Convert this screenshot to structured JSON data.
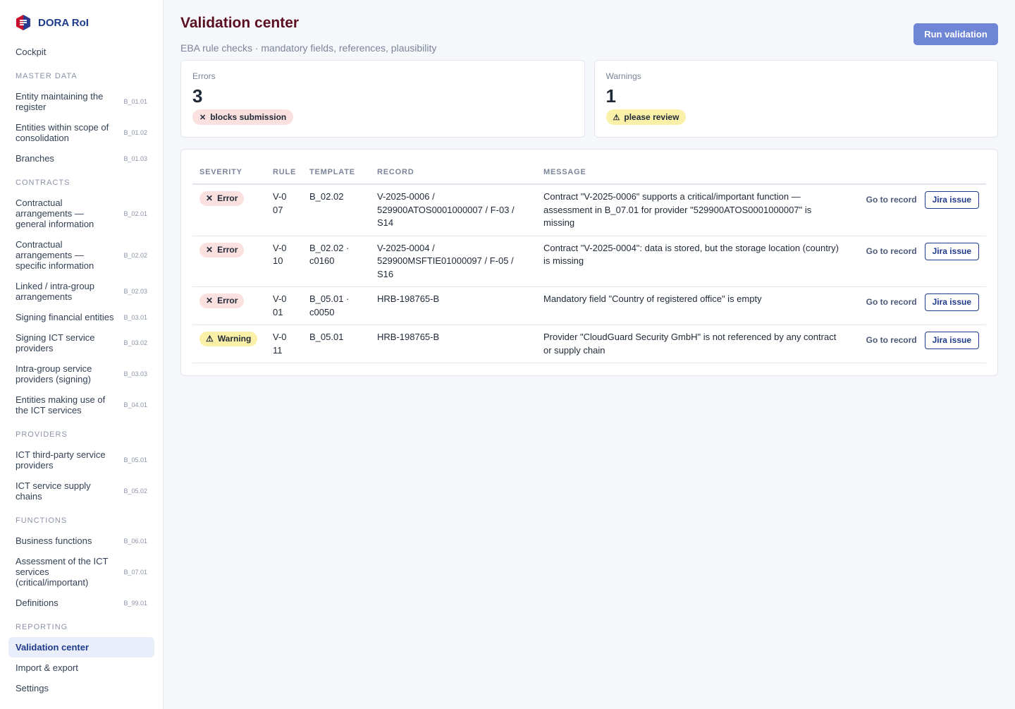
{
  "app": {
    "title": "DORA RoI"
  },
  "sidebar": {
    "cockpit": "Cockpit",
    "sections": {
      "master_data": "MASTER DATA",
      "contracts": "CONTRACTS",
      "providers": "PROVIDERS",
      "functions": "FUNCTIONS",
      "reporting": "REPORTING"
    },
    "items": {
      "b0101": {
        "label": "Entity maintaining the register",
        "code": "B_01.01"
      },
      "b0102": {
        "label": "Entities within scope of consolidation",
        "code": "B_01.02"
      },
      "b0103": {
        "label": "Branches",
        "code": "B_01.03"
      },
      "b0201": {
        "label": "Contractual arrangements — general information",
        "code": "B_02.01"
      },
      "b0202": {
        "label": "Contractual arrangements — specific information",
        "code": "B_02.02"
      },
      "b0203": {
        "label": "Linked / intra-group arrangements",
        "code": "B_02.03"
      },
      "b0301": {
        "label": "Signing financial entities",
        "code": "B_03.01"
      },
      "b0302": {
        "label": "Signing ICT service providers",
        "code": "B_03.02"
      },
      "b0303": {
        "label": "Intra-group service providers (signing)",
        "code": "B_03.03"
      },
      "b0401": {
        "label": "Entities making use of the ICT services",
        "code": "B_04.01"
      },
      "b0501": {
        "label": "ICT third-party service providers",
        "code": "B_05.01"
      },
      "b0502": {
        "label": "ICT service supply chains",
        "code": "B_05.02"
      },
      "b0601": {
        "label": "Business functions",
        "code": "B_06.01"
      },
      "b0701": {
        "label": "Assessment of the ICT services (critical/important)",
        "code": "B_07.01"
      },
      "b9901": {
        "label": "Definitions",
        "code": "B_99.01"
      }
    },
    "validation_center": "Validation center",
    "import_export": "Import & export",
    "settings": "Settings"
  },
  "page": {
    "title": "Validation center",
    "subtitle": "EBA rule checks · mandatory fields, references, plausibility",
    "run_button": "Run validation"
  },
  "summary": {
    "errors": {
      "label": "Errors",
      "value": "3",
      "badge": "blocks submission",
      "badge_icon": "✕"
    },
    "warnings": {
      "label": "Warnings",
      "value": "1",
      "badge": "please review",
      "badge_icon": "⚠"
    }
  },
  "table": {
    "columns": [
      "SEVERITY",
      "RULE",
      "TEMPLATE",
      "RECORD",
      "MESSAGE"
    ],
    "rows": [
      {
        "severity": "Error",
        "severity_icon": "✕",
        "rule": "V-007",
        "template": "B_02.02",
        "record": "V-2025-0006 / 529900ATOS0001000007 / F-03 / S14",
        "message": "Contract \"V-2025-0006\" supports a critical/important function — assessment in B_07.01 for provider \"529900ATOS0001000007\" is missing",
        "goto": "Go to record",
        "jira": "Jira issue"
      },
      {
        "severity": "Error",
        "severity_icon": "✕",
        "rule": "V-010",
        "template": "B_02.02 · c0160",
        "record": "V-2025-0004 / 529900MSFTIE01000097 / F-05 / S16",
        "message": "Contract \"V-2025-0004\": data is stored, but the storage location (country) is missing",
        "goto": "Go to record",
        "jira": "Jira issue"
      },
      {
        "severity": "Error",
        "severity_icon": "✕",
        "rule": "V-001",
        "template": "B_05.01 · c0050",
        "record": "HRB-198765-B",
        "message": "Mandatory field \"Country of registered office\" is empty",
        "goto": "Go to record",
        "jira": "Jira issue"
      },
      {
        "severity": "Warning",
        "severity_icon": "⚠",
        "rule": "V-011",
        "template": "B_05.01",
        "record": "HRB-198765-B",
        "message": "Provider \"CloudGuard Security GmbH\" is not referenced by any contract or supply chain",
        "goto": "Go to record",
        "jira": "Jira issue"
      }
    ]
  },
  "colors": {
    "brand": "#1e3a8a",
    "title": "#5b1022",
    "primary_button": "#6f86d6",
    "error_pill": "#fbe0e0",
    "warning_pill": "#fbf0a8"
  }
}
